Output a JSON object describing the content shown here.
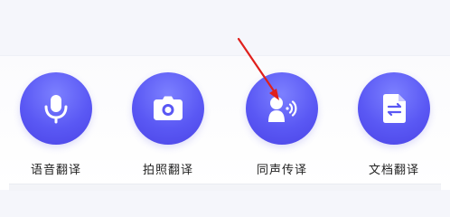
{
  "tools": [
    {
      "label": "语音翻译",
      "icon": "microphone-icon"
    },
    {
      "label": "拍照翻译",
      "icon": "camera-icon"
    },
    {
      "label": "同声传译",
      "icon": "speaking-person-icon"
    },
    {
      "label": "文档翻译",
      "icon": "document-swap-icon"
    }
  ],
  "colors": {
    "circle_accent": "#5a58f4",
    "annotation_arrow": "#e0201c",
    "label_text": "#222222"
  }
}
